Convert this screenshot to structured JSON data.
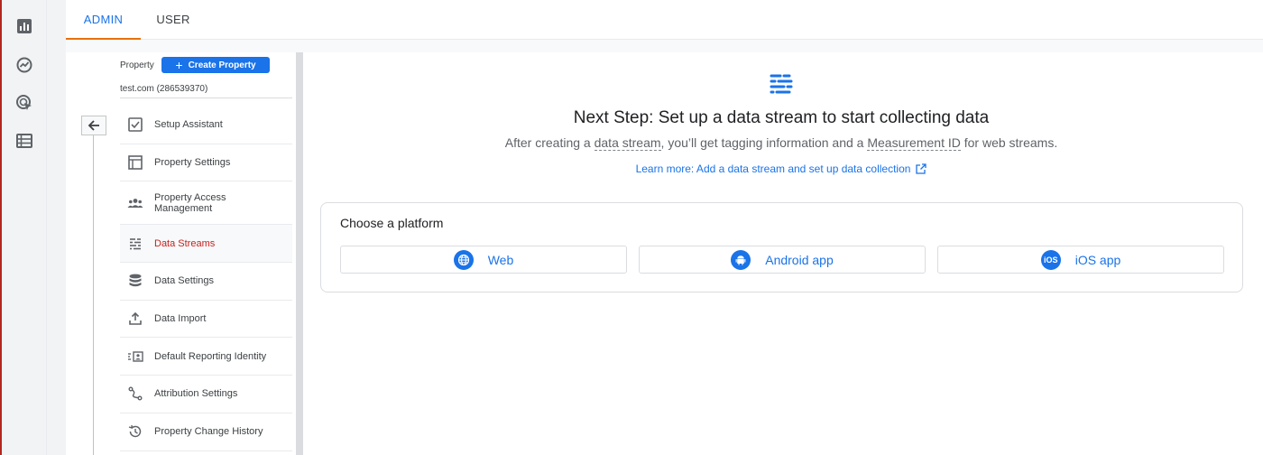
{
  "tabs": {
    "admin": "ADMIN",
    "user": "USER"
  },
  "property": {
    "label": "Property",
    "create_button": "Create Property",
    "name": "test.com (286539370)"
  },
  "menu": {
    "items": [
      {
        "label": "Setup Assistant",
        "icon": "checklist-icon"
      },
      {
        "label": "Property Settings",
        "icon": "property-settings-icon"
      },
      {
        "label": "Property Access Management",
        "icon": "people-icon"
      },
      {
        "label": "Data Streams",
        "icon": "data-streams-icon",
        "active": true
      },
      {
        "label": "Data Settings",
        "icon": "database-icon"
      },
      {
        "label": "Data Import",
        "icon": "upload-icon"
      },
      {
        "label": "Default Reporting Identity",
        "icon": "identity-icon"
      },
      {
        "label": "Attribution Settings",
        "icon": "attribution-icon"
      },
      {
        "label": "Property Change History",
        "icon": "history-icon"
      }
    ]
  },
  "main": {
    "headline": "Next Step: Set up a data stream to start collecting data",
    "sub_before": "After creating a ",
    "sub_term1": "data stream",
    "sub_middle": ", you’ll get tagging information and a ",
    "sub_term2": "Measurement ID",
    "sub_after": " for web streams.",
    "learn_more": "Learn more: Add a data stream and set up data collection",
    "choose_platform": "Choose a platform",
    "platforms": [
      {
        "label": "Web",
        "icon": "globe-icon"
      },
      {
        "label": "Android app",
        "icon": "android-icon"
      },
      {
        "label": "iOS app",
        "icon": "ios-icon",
        "badge": "iOS"
      }
    ]
  },
  "colors": {
    "accent": "#1a73e8",
    "tab_underline": "#e8710a",
    "active_item": "#c5221f"
  }
}
